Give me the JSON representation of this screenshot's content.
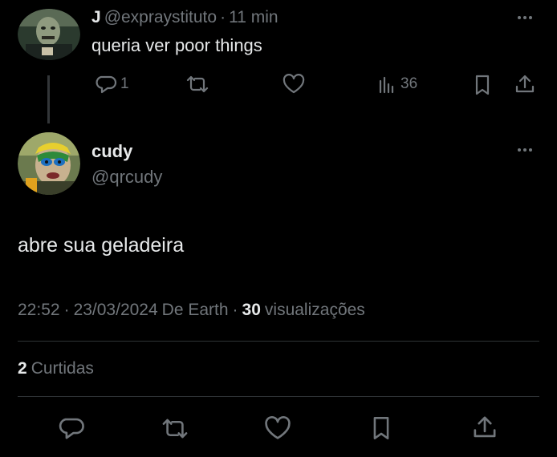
{
  "reply_tweet": {
    "display_name": "J",
    "handle": "@expraystituto",
    "separator": "·",
    "time": "11 min",
    "text": "queria ver poor things",
    "reply_count": "1",
    "views": "36"
  },
  "main_tweet": {
    "display_name": "cudy",
    "handle": "@qrcudy",
    "text": "abre sua geladeira",
    "time": "22:52",
    "sep1": "·",
    "date": "23/03/2024",
    "source": "De Earth",
    "sep2": "·",
    "views_count": "30",
    "views_label": "visualizações",
    "likes_count": "2",
    "likes_label": "Curtidas"
  },
  "icons": {
    "more": "more-dots-icon",
    "reply": "reply-bubble-icon",
    "retweet": "retweet-icon",
    "like": "heart-icon",
    "views": "bar-chart-icon",
    "bookmark": "bookmark-icon",
    "share": "share-upload-icon"
  },
  "colors": {
    "background": "#000000",
    "text": "#e7e9ea",
    "secondary": "#71767b",
    "divider": "#2f3336"
  }
}
